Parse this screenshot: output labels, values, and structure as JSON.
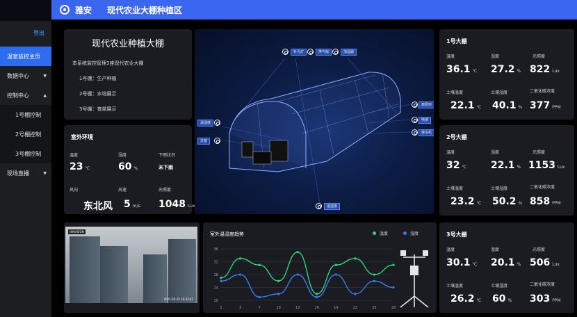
{
  "header": {
    "app_name": "雅安",
    "page_title": "现代农业大棚种植区"
  },
  "sidebar": {
    "login": "登出",
    "items": [
      {
        "label": "温室监控主页",
        "active": true
      },
      {
        "label": "数据中心",
        "caret": "▼"
      },
      {
        "label": "控制中心",
        "caret": "▲"
      },
      {
        "label": "1号棚控制",
        "sub": true
      },
      {
        "label": "2号棚控制",
        "sub": true
      },
      {
        "label": "3号棚控制",
        "sub": true
      },
      {
        "label": "现场直播",
        "caret": "▼"
      }
    ]
  },
  "intro": {
    "title": "现代农业种植大棚",
    "desc": "本系统监控管理3座现代农业大棚",
    "lines": [
      "1号棚：生产种植",
      "2号棚：水培展示",
      "3号棚：育苗展示"
    ]
  },
  "outdoor": {
    "title": "室外环境",
    "temp_label": "温度",
    "temp_value": "23",
    "temp_unit": "℃",
    "hum_label": "湿度",
    "hum_value": "60",
    "hum_unit": "%",
    "rain_label": "下雨状况",
    "rain_value": "未下雨",
    "wind_dir_label": "风向",
    "wind_dir_value": "东北风",
    "wind_speed_label": "风速",
    "wind_speed_value": "5",
    "wind_speed_unit": "m/s",
    "light_label": "光照度",
    "light_value": "1048",
    "light_unit": "Lux"
  },
  "scene": {
    "tags": [
      "补光灯",
      "排气扇",
      "加湿器",
      "遮阳帘",
      "喷淋",
      "卷帘机",
      "温湿度",
      "天窗"
    ]
  },
  "greenhouses": [
    {
      "title": "1号大棚",
      "temp_label": "温度",
      "temp_value": "36.1",
      "temp_unit": "℃",
      "hum_label": "湿度",
      "hum_value": "27.2",
      "hum_unit": "%",
      "light_label": "光照度",
      "light_value": "822",
      "light_unit": "Lux",
      "soil_temp_label": "土壤温度",
      "soil_temp_value": "22.1",
      "soil_temp_unit": "℃",
      "soil_hum_label": "土壤湿度",
      "soil_hum_value": "40.1",
      "soil_hum_unit": "%",
      "co2_label": "二氧化碳浓度",
      "co2_value": "377",
      "co2_unit": "PPM"
    },
    {
      "title": "2号大棚",
      "temp_label": "温度",
      "temp_value": "32",
      "temp_unit": "℃",
      "hum_label": "湿度",
      "hum_value": "22.1",
      "hum_unit": "%",
      "light_label": "光照度",
      "light_value": "1153",
      "light_unit": "Lux",
      "soil_temp_label": "土壤温度",
      "soil_temp_value": "23.2",
      "soil_temp_unit": "℃",
      "soil_hum_label": "土壤湿度",
      "soil_hum_value": "50.2",
      "soil_hum_unit": "%",
      "co2_label": "二氧化碳浓度",
      "co2_value": "858",
      "co2_unit": "PPM"
    },
    {
      "title": "3号大棚",
      "temp_label": "温度",
      "temp_value": "30.1",
      "temp_unit": "℃",
      "hum_label": "湿度",
      "hum_value": "20.1",
      "hum_unit": "%",
      "light_label": "光照度",
      "light_value": "506",
      "light_unit": "Lux",
      "soil_temp_label": "土壤温度",
      "soil_temp_value": "26.2",
      "soil_temp_unit": "℃",
      "soil_hum_label": "土壤湿度",
      "soil_hum_value": "60",
      "soil_hum_unit": "%",
      "co2_label": "二氧化碳浓度",
      "co2_value": "303",
      "co2_unit": "PPM"
    }
  ],
  "camera": {
    "timestamp": "2021-05-25 16:33:47",
    "brand": "HIKVISION"
  },
  "chart_data": {
    "type": "line",
    "title": "室外温湿度趋势",
    "x": [
      "1",
      "3",
      "7",
      "10",
      "13",
      "16",
      "19",
      "22",
      "25",
      "28"
    ],
    "ylim": [
      20,
      36
    ],
    "yticks": [
      "20",
      "24",
      "28",
      "32",
      "36"
    ],
    "series": [
      {
        "name": "温度",
        "color": "#2ed47a",
        "values": [
          27,
          33,
          31,
          26,
          35,
          22,
          31,
          33,
          28,
          31
        ]
      },
      {
        "name": "湿度",
        "color": "#3b7bf0",
        "values": [
          26,
          28,
          21,
          22,
          28,
          21,
          28,
          22,
          26,
          24
        ]
      }
    ]
  }
}
